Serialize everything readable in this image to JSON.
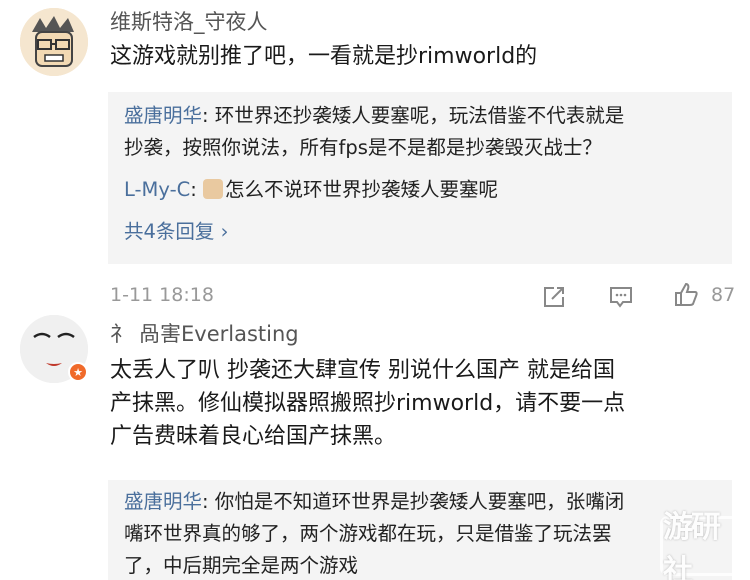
{
  "comments": [
    {
      "username": "维斯特洛_守夜人",
      "text": "这游戏就别推了吧，一看就是抄rimworld的",
      "replies": [
        {
          "name": "盛唐明华",
          "text_line1": "环世界还抄袭矮人要塞呢，玩法借鉴不代表就是",
          "text_line2": "抄袭，按照你说法，所有fps是不是都是抄袭毁灭战士？"
        },
        {
          "name": "L-My-C",
          "text": "怎么不说环世界抄袭矮人要塞呢"
        }
      ],
      "more_replies": "共4条回复 ›",
      "timestamp": "1-11 18:18",
      "like_count": "87"
    },
    {
      "username_prefix": "礻",
      "username": "咼害Everlasting",
      "text_lines": [
        "太丢人了叭 抄袭还大肆宣传 别说什么国产 就是给国",
        "产抹黑。修仙模拟器照搬照抄rimworld，请不要一点",
        "广告费昧着良心给国产抹黑。"
      ],
      "replies": [
        {
          "name": "盛唐明华",
          "lines": [
            "你怕是不知道环世界是抄袭矮人要塞吧，张嘴闭",
            "嘴环世界真的够了，两个游戏都在玩，只是借鉴了玩法罢",
            "了，中后期完全是两个游戏"
          ]
        }
      ]
    }
  ],
  "watermark": "游研社",
  "icons": {
    "share": "share-icon",
    "comment": "comment-icon",
    "like": "thumbs-up-icon"
  }
}
